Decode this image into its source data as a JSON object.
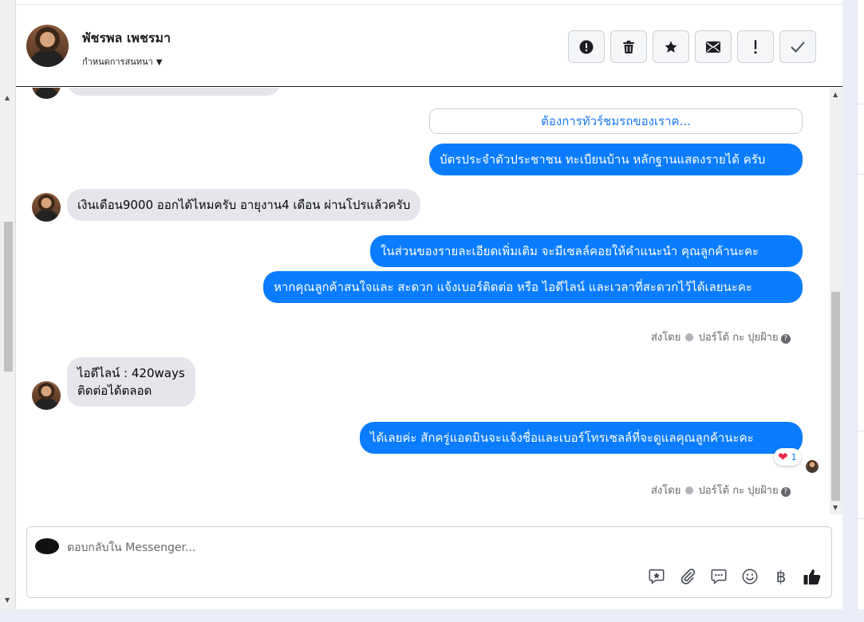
{
  "header": {
    "name": "พัชรพล เพชรมา",
    "assign_label": "กำหนดการสนทนา",
    "assign_caret": "▼"
  },
  "actions": [
    {
      "icon": "alert-circle-icon"
    },
    {
      "icon": "trash-icon"
    },
    {
      "icon": "star-icon"
    },
    {
      "icon": "envelope-icon",
      "symbol": "✉"
    },
    {
      "icon": "exclamation-icon",
      "symbol": "!"
    },
    {
      "icon": "checkmark-icon",
      "symbol": "✓"
    }
  ],
  "chat": {
    "quick_reply": "ต้องการทัวร์ชมรถของเราค...",
    "messages": {
      "m1": "บัตรประจำตัวประชาชน ทะเบียนบ้าน หลักฐานแสดงรายได้ ครับ",
      "m2": "เงินเดือน9000 ออกได้ไหมครับ อายุงาน4 เดือน ผ่านโปรแล้วครับ",
      "m3": "ในส่วนของรายละเอียดเพิ่มเติม จะมีเซลล์คอยให้คำแนะนำ คุณลูกค้านะคะ",
      "m4": "หากคุณลูกค้าสนใจและ สะดวก แจ้งเบอร์ติดต่อ หรือ ไอดีไลน์ และเวลาที่สะดวกไว้ได้เลยนะคะ",
      "m5_line1": "ไอดีไลน์ : 420ways",
      "m5_line2": "ติดต่อได้ตลอด",
      "m6": "ได้เลยค่ะ สักครู่แอดมินจะแจ้งชื่อและเบอร์โทรเซลล์ที่จะดูแลคุณลูกค้านะคะ"
    },
    "sent_by": {
      "prefix": "ส่งโดย",
      "name": "ปอร์โต้ กะ ปุยฝ้าย",
      "help": "?"
    },
    "reaction": {
      "emoji": "❤",
      "count": "1"
    }
  },
  "composer": {
    "placeholder": "ตอบกลับใน Messenger...",
    "tools": [
      "saved-reply-icon",
      "paperclip-icon",
      "chat-bubble-icon",
      "emoji-icon",
      "baht-icon",
      "thumbs-up-icon"
    ],
    "baht_symbol": "฿"
  },
  "colors": {
    "accent": "#0a7cff",
    "incoming": "#e4e6eb"
  }
}
